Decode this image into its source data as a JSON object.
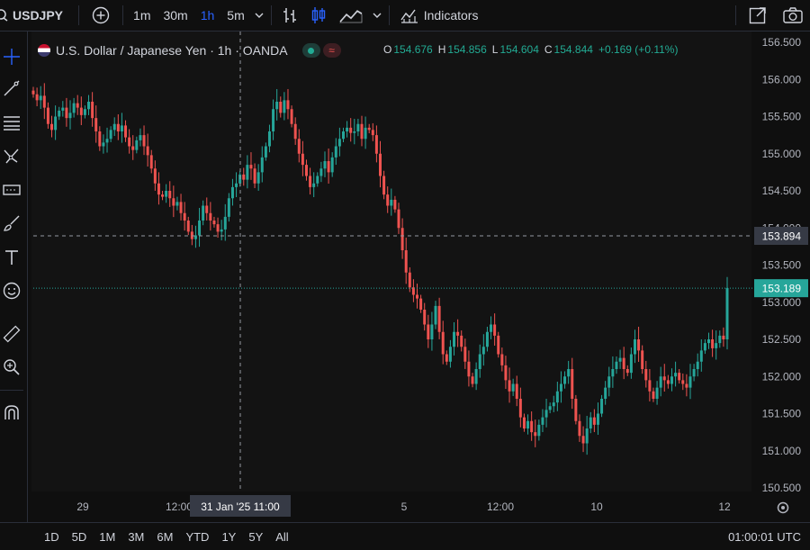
{
  "toolbar": {
    "symbol": "USDJPY",
    "intervals": [
      "1m",
      "30m",
      "1h",
      "5m"
    ],
    "active_interval": "1h",
    "indicators_label": "Indicators"
  },
  "legend": {
    "title": "U.S. Dollar / Japanese Yen · 1h · OANDA",
    "o_label": "O",
    "o": "154.676",
    "h_label": "H",
    "h": "154.856",
    "l_label": "L",
    "l": "154.604",
    "c_label": "C",
    "c": "154.844",
    "change": "+0.169 (+0.11%)",
    "badge": "≈"
  },
  "bottom": {
    "ranges": [
      "1D",
      "5D",
      "1M",
      "3M",
      "6M",
      "YTD",
      "1Y",
      "5Y",
      "All"
    ],
    "clock": "01:00:01 UTC"
  },
  "colors": {
    "up": "#26a69a",
    "down": "#ef5350",
    "bg": "#131313",
    "accent": "#2962ff"
  },
  "icons": [
    "search-icon",
    "add-symbol-icon",
    "chevron-down-icon",
    "bar-style-icon",
    "candle-style-icon",
    "area-style-icon",
    "indicators-icon",
    "fullscreen-icon",
    "camera-icon",
    "crosshair-icon",
    "trendline-icon",
    "fib-icon",
    "pattern-icon",
    "projection-icon",
    "brush-icon",
    "text-icon",
    "emoji-icon",
    "ruler-icon",
    "zoom-icon",
    "magnet-icon",
    "settings-icon"
  ],
  "chart_data": {
    "type": "candlestick",
    "title": "U.S. Dollar / Japanese Yen · 1h · OANDA",
    "ylim": [
      150.37,
      156.63
    ],
    "y_ticks": [
      "156.500",
      "156.000",
      "155.500",
      "155.000",
      "154.500",
      "154.000",
      "153.500",
      "153.000",
      "152.500",
      "152.000",
      "151.500",
      "151.000",
      "150.500"
    ],
    "x_ticks": [
      "29",
      "12:00",
      "5",
      "12:00",
      "10",
      "12"
    ],
    "crosshair_label": "31 Jan '25  11:00",
    "crosshair_price": "153.894",
    "last_price": "153.189",
    "grid": false,
    "legend": "top-left",
    "closes": [
      155.8,
      155.72,
      155.78,
      155.62,
      155.4,
      155.32,
      155.5,
      155.58,
      155.62,
      155.48,
      155.55,
      155.68,
      155.62,
      155.52,
      155.6,
      155.7,
      155.48,
      155.3,
      155.1,
      155.15,
      155.2,
      155.32,
      155.4,
      155.3,
      155.38,
      155.22,
      155.1,
      155.05,
      155.18,
      155.25,
      155.1,
      154.98,
      154.8,
      154.6,
      154.45,
      154.42,
      154.5,
      154.4,
      154.3,
      154.35,
      154.2,
      154.1,
      153.95,
      153.85,
      153.9,
      154.1,
      154.3,
      154.2,
      154.1,
      154.05,
      153.95,
      153.98,
      154.15,
      154.4,
      154.55,
      154.6,
      154.72,
      154.65,
      154.85,
      154.8,
      154.6,
      154.75,
      154.95,
      155.1,
      155.3,
      155.6,
      155.7,
      155.55,
      155.72,
      155.6,
      155.4,
      155.2,
      155.0,
      154.85,
      154.7,
      154.55,
      154.6,
      154.7,
      154.8,
      154.9,
      154.75,
      154.95,
      155.1,
      155.2,
      155.3,
      155.35,
      155.28,
      155.3,
      155.4,
      155.2,
      155.35,
      155.32,
      155.25,
      155.0,
      154.7,
      154.45,
      154.3,
      154.38,
      154.25,
      154.0,
      153.7,
      153.4,
      153.2,
      153.1,
      153.05,
      152.9,
      152.7,
      152.5,
      152.7,
      152.95,
      152.6,
      152.3,
      152.2,
      152.4,
      152.6,
      152.55,
      152.4,
      152.2,
      152.0,
      151.9,
      152.1,
      152.3,
      152.4,
      152.6,
      152.7,
      152.55,
      152.3,
      152.15,
      151.95,
      151.8,
      151.9,
      151.7,
      151.45,
      151.3,
      151.4,
      151.25,
      151.2,
      151.35,
      151.45,
      151.55,
      151.6,
      151.65,
      151.8,
      151.9,
      152.0,
      152.1,
      151.7,
      151.4,
      151.2,
      151.1,
      151.3,
      151.45,
      151.35,
      151.5,
      151.7,
      151.85,
      152.0,
      152.1,
      152.2,
      152.25,
      152.1,
      152.05,
      152.3,
      152.5,
      152.35,
      152.1,
      151.95,
      151.8,
      151.7,
      151.85,
      152.0,
      151.95,
      151.9,
      152.0,
      152.05,
      151.95,
      151.9,
      151.85,
      152.0,
      152.1,
      152.2,
      152.35,
      152.45,
      152.5,
      152.38,
      152.45,
      152.55,
      152.5,
      153.19
    ]
  }
}
